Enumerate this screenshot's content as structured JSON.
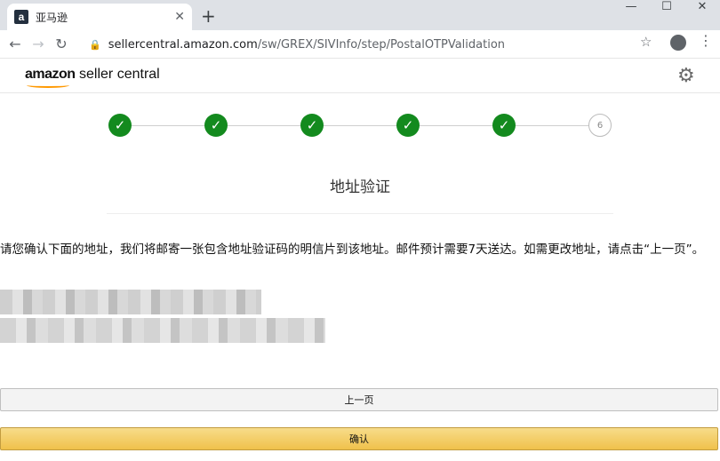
{
  "browser": {
    "tab_title": "亚马逊",
    "favicon": "a",
    "new_tab_glyph": "+",
    "close_glyph": "✕",
    "url_host": "sellercentral.amazon.com",
    "url_path": "/sw/GREX/SIVInfo/step/PostalOTPValidation"
  },
  "header": {
    "logo_bold": "amazon",
    "logo_rest": " seller central",
    "settings_icon": "gear-icon"
  },
  "stepper": {
    "steps": [
      {
        "label": "✓",
        "state": "complete"
      },
      {
        "label": "✓",
        "state": "complete"
      },
      {
        "label": "✓",
        "state": "complete"
      },
      {
        "label": "✓",
        "state": "complete"
      },
      {
        "label": "✓",
        "state": "complete"
      },
      {
        "label": "6",
        "state": "pending"
      }
    ]
  },
  "main": {
    "heading": "地址验证",
    "instruction": "请您确认下面的地址，我们将邮寄一张包含地址验证码的明信片到该地址。邮件预计需要7天送达。如需更改地址，请点击“上一页”。"
  },
  "buttons": {
    "previous_label": "上一页",
    "confirm_label": "确认"
  },
  "colors": {
    "step_complete": "#138a1e",
    "confirm_button": "#f0c14b",
    "logo_smile": "#ff9900"
  }
}
